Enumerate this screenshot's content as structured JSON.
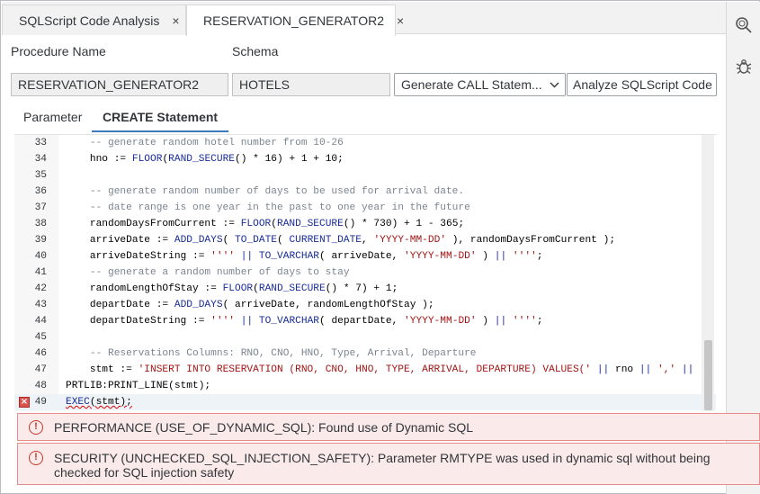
{
  "tabs": [
    {
      "label": "SQLScript Code Analysis",
      "close": "×"
    },
    {
      "label": "RESERVATION_GENERATOR2",
      "close": "×"
    }
  ],
  "sidebar_icons": [
    "search-icon",
    "bug-icon"
  ],
  "form": {
    "procedure_label": "Procedure Name",
    "schema_label": "Schema",
    "procedure_value": "RESERVATION_GENERATOR2",
    "schema_value": "HOTELS",
    "generate_select": "Generate CALL Statem...",
    "analyze_button": "Analyze SQLScript Code"
  },
  "subtabs": [
    "Parameter",
    "CREATE Statement"
  ],
  "editor": {
    "lines": [
      {
        "n": "33",
        "code": "    -- generate random hotel number from 10-26"
      },
      {
        "n": "34",
        "code": "    hno := FLOOR(RAND_SECURE() * 16) + 1 + 10;"
      },
      {
        "n": "35",
        "code": ""
      },
      {
        "n": "36",
        "code": "    -- generate random number of days to be used for arrival date."
      },
      {
        "n": "37",
        "code": "    -- date range is one year in the past to one year in the future"
      },
      {
        "n": "38",
        "code": "    randomDaysFromCurrent := FLOOR(RAND_SECURE() * 730) + 1 - 365;"
      },
      {
        "n": "39",
        "code": "    arriveDate := ADD_DAYS( TO_DATE( CURRENT_DATE, 'YYYY-MM-DD' ), randomDaysFromCurrent );"
      },
      {
        "n": "40",
        "code": "    arriveDateString := '''' || TO_VARCHAR( arriveDate, 'YYYY-MM-DD' ) || '''';"
      },
      {
        "n": "41",
        "code": "    -- generate a random number of days to stay"
      },
      {
        "n": "42",
        "code": "    randomLengthOfStay := FLOOR(RAND_SECURE() * 7) + 1;"
      },
      {
        "n": "43",
        "code": "    departDate := ADD_DAYS( arriveDate, randomLengthOfStay );"
      },
      {
        "n": "44",
        "code": "    departDateString := '''' || TO_VARCHAR( departDate, 'YYYY-MM-DD' ) || '''';"
      },
      {
        "n": "45",
        "code": ""
      },
      {
        "n": "46",
        "code": "    -- Reservations Columns: RNO, CNO, HNO, Type, Arrival, Departure"
      },
      {
        "n": "47",
        "code": "    stmt := 'INSERT INTO RESERVATION (RNO, CNO, HNO, TYPE, ARRIVAL, DEPARTURE) VALUES(' || rno || ',' ||"
      },
      {
        "n": "48",
        "code": "PRTLIB:PRINT_LINE(stmt);"
      },
      {
        "n": "49",
        "code": "EXEC(stmt);"
      }
    ],
    "error_line": "49"
  },
  "messages": [
    {
      "text": "PERFORMANCE (USE_OF_DYNAMIC_SQL): Found use of Dynamic SQL"
    },
    {
      "text": "SECURITY (UNCHECKED_SQL_INJECTION_SAFETY): Parameter RMTYPE was used in dynamic sql without being checked for SQL injection safety"
    }
  ],
  "colors": {
    "accent": "#3c7bbd",
    "error": "#c0392b",
    "error_bg": "#fbeaea"
  }
}
